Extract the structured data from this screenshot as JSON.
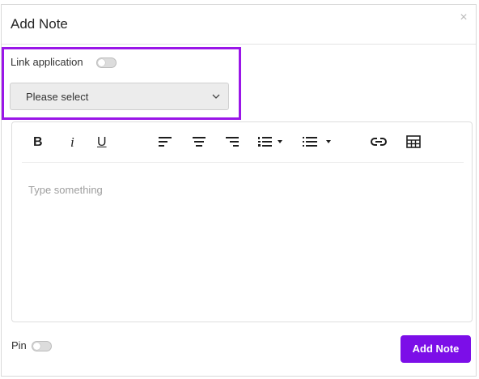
{
  "dialog": {
    "title": "Add Note",
    "close_icon": "close-icon",
    "close_glyph": "×"
  },
  "link_application": {
    "label": "Link application",
    "toggle_on": false,
    "select_value": "Please select",
    "highlight_color": "#9a16e8"
  },
  "toolbar": {
    "bold": "B",
    "italic": "i",
    "underline": "U",
    "icons": [
      "bold-icon",
      "italic-icon",
      "underline-icon",
      "align-left-icon",
      "align-center-icon",
      "align-right-icon",
      "ordered-list-icon",
      "bullet-list-icon",
      "link-icon",
      "table-icon"
    ]
  },
  "editor": {
    "placeholder": "Type something"
  },
  "pin": {
    "label": "Pin",
    "toggle_on": false
  },
  "actions": {
    "add_note_label": "Add Note",
    "accent_color": "#7c0ee8"
  }
}
